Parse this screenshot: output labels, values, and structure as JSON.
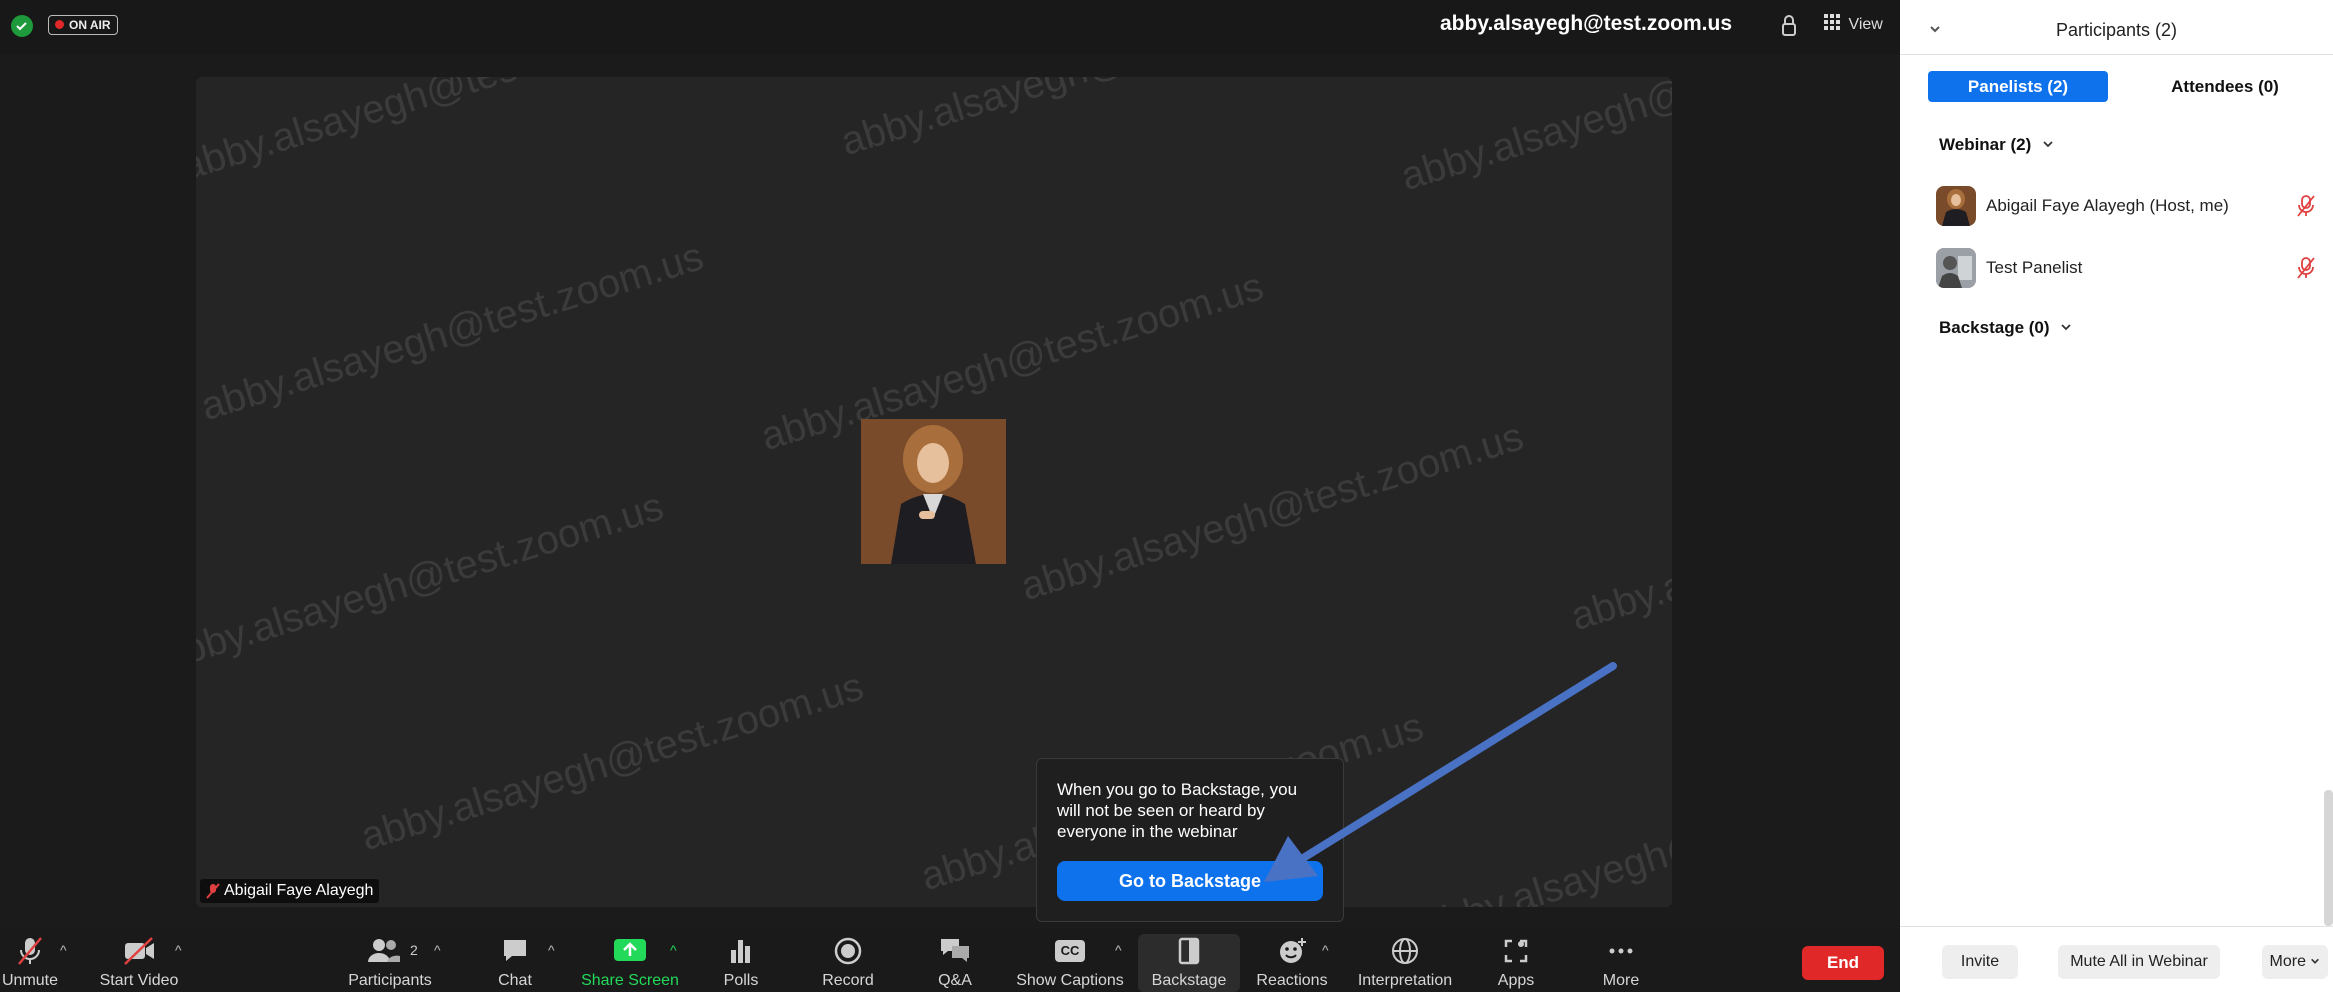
{
  "topbar": {
    "on_air": "ON AIR",
    "account": "abby.alsayegh@test.zoom.us",
    "view_label": "View"
  },
  "stage": {
    "watermark": "abby.alsayegh@test.zoom.us",
    "name_tag": "Abigail Faye Alayegh"
  },
  "popup": {
    "message": "When you go to Backstage, you will not be seen or heard by everyone in the webinar",
    "button": "Go to Backstage"
  },
  "toolbar": {
    "unmute": "Unmute",
    "start_video": "Start Video",
    "participants": "Participants",
    "participants_count": "2",
    "chat": "Chat",
    "share_screen": "Share Screen",
    "polls": "Polls",
    "record": "Record",
    "qa": "Q&A",
    "show_captions": "Show Captions",
    "cc": "CC",
    "backstage": "Backstage",
    "reactions": "Reactions",
    "interpretation": "Interpretation",
    "apps": "Apps",
    "more": "More",
    "end": "End"
  },
  "panel": {
    "title": "Participants (2)",
    "tab_panelists": "Panelists (2)",
    "tab_attendees": "Attendees (0)",
    "group_webinar": "Webinar (2)",
    "participants": [
      {
        "name": "Abigail Faye Alayegh (Host, me)"
      },
      {
        "name": "Test Panelist"
      }
    ],
    "group_backstage": "Backstage (0)",
    "invite": "Invite",
    "mute_all": "Mute All in Webinar",
    "more": "More"
  },
  "colors": {
    "accent_blue": "#0e72ed",
    "end_red": "#e02828",
    "share_green": "#23d959",
    "muted_red": "#e04040",
    "arrow_blue": "#4a72c4"
  }
}
